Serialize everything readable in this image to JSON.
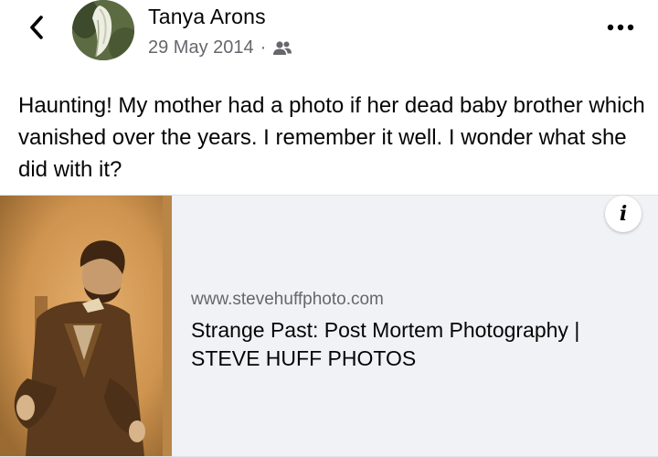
{
  "post": {
    "author_name": "Tanya Arons",
    "date": "29 May 2014",
    "separator": "·",
    "audience_icon": "friends-icon",
    "text": "Haunting!  My mother had a photo if her dead baby brother which vanished over the years.  I remember it well.  I wonder what she did with it?"
  },
  "link": {
    "domain": "www.stevehuffphoto.com",
    "title": "Strange Past: Post Mortem Photography | STEVE HUFF PHOTOS",
    "info_label": "i"
  },
  "icons": {
    "back": "chevron-left-icon",
    "more": "more-options-icon"
  },
  "colors": {
    "text_primary": "#050505",
    "text_secondary": "#65676b",
    "card_background": "#f0f2f5"
  }
}
